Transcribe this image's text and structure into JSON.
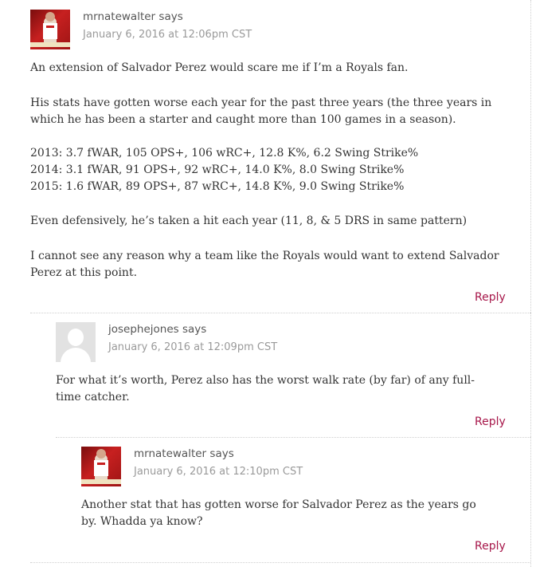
{
  "comments": [
    {
      "author": "mrnatewalter",
      "says": "says",
      "date": "January 6, 2016 at 12:06pm CST",
      "avatar": "team-photo-avatar",
      "paragraphs": [
        "An extension of Salvador Perez would scare me if I’m a Royals fan.",
        "His stats have gotten worse each year for the past three years (the three years in which he has been a starter and caught more than 100 games in a season).",
        "2013: 3.7 fWAR, 105 OPS+, 106 wRC+, 12.8 K%, 6.2 Swing Strike%",
        "2014: 3.1 fWAR, 91 OPS+, 92 wRC+, 14.0 K%, 8.0 Swing Strike%",
        "2015: 1.6 fWAR, 89 OPS+, 87 wRC+, 14.8 K%, 9.0 Swing Strike%",
        "Even defensively, he’s taken a hit each year (11, 8, & 5 DRS in same pattern)",
        "I cannot see any reason why a team like the Royals would want to extend Salvador Perez at this point."
      ],
      "reply": "Reply"
    },
    {
      "author": "josephejones",
      "says": "says",
      "date": "January 6, 2016 at 12:09pm CST",
      "avatar": "default-user-avatar",
      "paragraphs": [
        "For what it’s worth, Perez also has the worst walk rate (by far) of any full-time catcher."
      ],
      "reply": "Reply"
    },
    {
      "author": "mrnatewalter",
      "says": "says",
      "date": "January 6, 2016 at 12:10pm CST",
      "avatar": "team-photo-avatar",
      "paragraphs": [
        "Another stat that has gotten worse for Salvador Perez as the years go by. Whadda ya know?"
      ],
      "reply": "Reply"
    }
  ],
  "colors": {
    "reply_link": "#a7174a",
    "meta_text": "#9a9a9a",
    "body_text": "#333333",
    "separator": "#cfcfcf"
  }
}
